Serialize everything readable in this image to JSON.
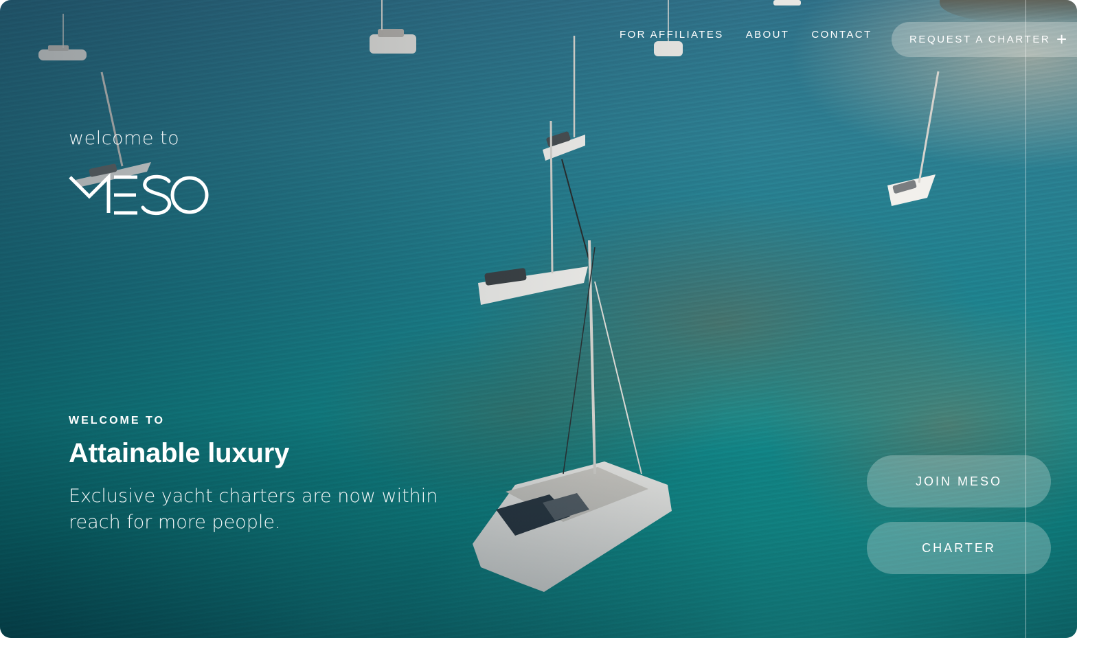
{
  "nav": {
    "items": [
      {
        "label": "FOR AFFILIATES"
      },
      {
        "label": "ABOUT"
      },
      {
        "label": "CONTACT"
      }
    ],
    "request_label": "REQUEST A CHARTER",
    "request_icon": "plus-icon"
  },
  "hero": {
    "welcome_small": "welcome to",
    "logo_text": "MESO",
    "eyebrow": "WELCOME TO",
    "headline": "Attainable luxury",
    "subhead": "Exclusive yacht charters are now within reach for more people."
  },
  "ctas": {
    "join_label": "JOIN MESO",
    "charter_label": "CHARTER"
  },
  "colors": {
    "ocean": "#1f7f8c",
    "text": "#ffffff",
    "glass_button": "rgba(225,235,232,0.30)"
  }
}
